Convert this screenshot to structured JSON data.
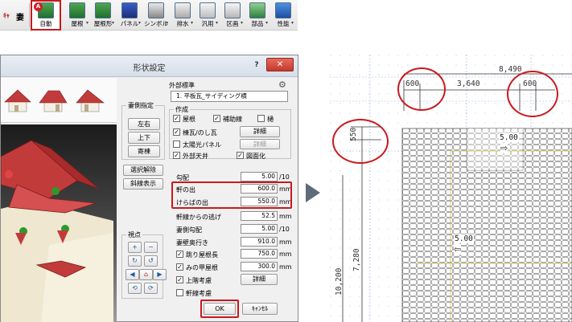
{
  "toolbar": {
    "items": [
      {
        "label": "自動",
        "icon": "roof-auto-icon",
        "badge": "A"
      },
      {
        "label": "屋根",
        "icon": "roof-icon"
      },
      {
        "label": "屋根形",
        "icon": "roof-shape-icon"
      },
      {
        "label": "パネル",
        "icon": "panel-icon"
      },
      {
        "label": "シンボル",
        "icon": "symbol-icon"
      },
      {
        "label": "排水",
        "icon": "drain-icon"
      },
      {
        "label": "汎用",
        "icon": "general-icon"
      },
      {
        "label": "区画",
        "icon": "section-icon"
      },
      {
        "label": "部品",
        "icon": "parts-icon"
      },
      {
        "label": "性能",
        "icon": "performance-icon"
      }
    ],
    "left_icons": [
      "ｷｬ",
      "妻"
    ]
  },
  "dialog": {
    "title": "形状設定",
    "help": "?",
    "close": "✕",
    "side_buttons": {
      "group_label": "妻側指定",
      "left_right": "左右",
      "up_down": "上下",
      "hip": "寄棟",
      "select_remove": "選択解除",
      "hip_display": "斜線表示"
    },
    "viewpoint_label": "視点",
    "exterior": {
      "label": "外部標準",
      "value": "1. 平板瓦_サイディング横"
    },
    "create": {
      "label": "作成",
      "roof": "屋根",
      "aux_line": "補助線",
      "gutter": "樋",
      "ridge_tile": "棟瓦/のし瓦",
      "solar_panel": "太陽光パネル",
      "exterior_ceiling": "外部天井",
      "drawing": "図面化",
      "detail_btn_1": "詳細",
      "detail_btn_2": "詳細"
    },
    "params": {
      "pitch_label": "勾配",
      "pitch_value": "5.00",
      "pitch_unit": "/10",
      "eave_label": "軒の出",
      "eave_value": "600.0",
      "eave_unit": "mm",
      "verge_label": "けらばの出",
      "verge_value": "550.0",
      "verge_unit": "mm",
      "hip_offset_label": "軒線からの逃げ",
      "hip_offset_value": "52.5",
      "hip_offset_unit": "mm",
      "gable_pitch_label": "妻側勾配",
      "gable_pitch_value": "5.00",
      "gable_pitch_unit": "/10",
      "gable_depth_label": "妻壁奥行き",
      "gable_depth_value": "910.0",
      "gable_depth_unit": "mm",
      "eave_roof_label": "跳り屋根長",
      "eave_roof_value": "750.0",
      "eave_roof_unit": "mm",
      "mino_label": "みの甲屋根",
      "mino_value": "300.0",
      "mino_unit": "mm",
      "upper_floor_label": "上階考慮",
      "upper_detail": "詳細",
      "eave_line_label": "軒線考慮"
    },
    "ok": "OK",
    "cancel": "ｷｬﾝｾﾙ"
  },
  "plan": {
    "top_dim": "8,490",
    "eave_left": "600",
    "span": "3,640",
    "eave_right": "600",
    "verge": "550",
    "side_dim_1": "7,280",
    "side_dim_2": "10,200",
    "slope_1": "5.00",
    "slope_2": "5.00"
  },
  "colors": {
    "highlight": "#c8191e",
    "roof_red": "#c23b3b",
    "marker_green": "#2a9a2a"
  }
}
